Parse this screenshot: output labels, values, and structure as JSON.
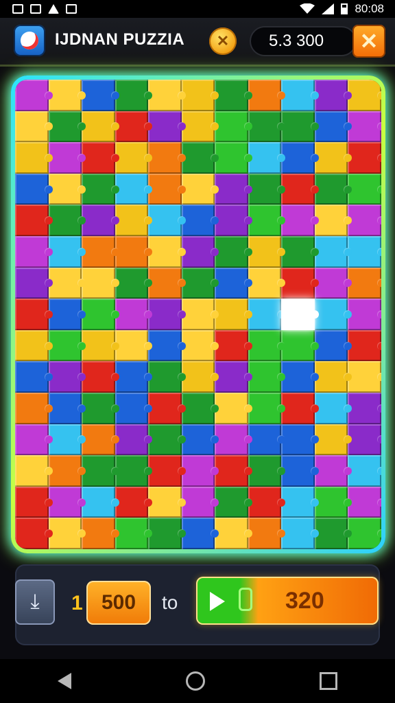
{
  "status_bar": {
    "time": "80:08"
  },
  "header": {
    "app_title": "IJDNAN PUZZIA",
    "coin_symbol": "✕",
    "score": "5.3 300",
    "close_symbol": "✕"
  },
  "board": {
    "columns": 11,
    "rows": 15,
    "palette": [
      "#1d63d9",
      "#f2c21a",
      "#8a2bc9",
      "#1f9a2e",
      "#e0261c",
      "#f27a10",
      "#35c2f0",
      "#2fc42f",
      "#c03ad6",
      "#ffd23a"
    ],
    "highlight_color": "#ffffff"
  },
  "bottom": {
    "hint_symbol": "⤓",
    "count": "1",
    "cost": "500",
    "to_label": "to",
    "play_value": "320"
  },
  "nav": {
    "buttons": [
      "back",
      "home",
      "recent"
    ]
  }
}
